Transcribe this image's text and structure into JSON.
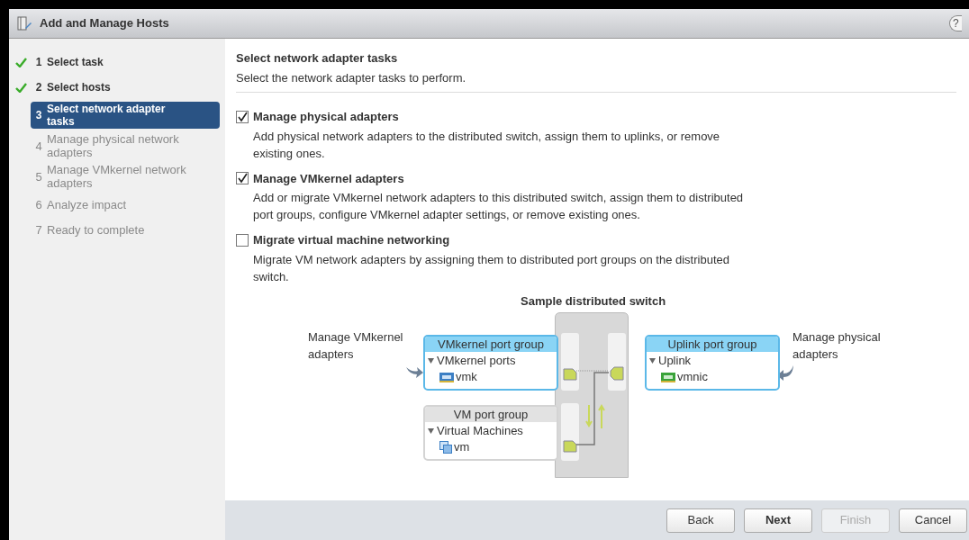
{
  "window": {
    "title": "Add and Manage Hosts",
    "help": "?"
  },
  "steps": [
    {
      "number": "1",
      "label": "Select task",
      "done": true,
      "selected": false,
      "disabled": false
    },
    {
      "number": "2",
      "label": "Select hosts",
      "done": true,
      "selected": false,
      "disabled": false
    },
    {
      "number": "3",
      "label": "Select network adapter tasks",
      "done": false,
      "selected": true,
      "disabled": false
    },
    {
      "number": "4",
      "label": "Manage physical network adapters",
      "done": false,
      "selected": false,
      "disabled": true
    },
    {
      "number": "5",
      "label": "Manage VMkernel network adapters",
      "done": false,
      "selected": false,
      "disabled": true
    },
    {
      "number": "6",
      "label": "Analyze impact",
      "done": false,
      "selected": false,
      "disabled": true
    },
    {
      "number": "7",
      "label": "Ready to complete",
      "done": false,
      "selected": false,
      "disabled": true
    }
  ],
  "page": {
    "title": "Select network adapter tasks",
    "subtitle": "Select the network adapter tasks to perform."
  },
  "tasks": [
    {
      "label": "Manage physical adapters",
      "checked": true,
      "description": "Add physical network adapters to the distributed switch, assign them to uplinks, or remove existing ones."
    },
    {
      "label": "Manage VMkernel adapters",
      "checked": true,
      "description": "Add or migrate VMkernel network adapters to this distributed switch, assign them to distributed port groups, configure VMkernel adapter settings, or remove existing ones."
    },
    {
      "label": "Migrate virtual machine networking",
      "checked": false,
      "description": "Migrate VM network adapters by assigning them to distributed port groups on the distributed switch."
    }
  ],
  "diagram": {
    "title": "Sample distributed switch",
    "left_note": "Manage VMkernel adapters",
    "right_note": "Manage physical adapters",
    "groups": [
      {
        "kind": "vmkernel",
        "title": "VMkernel port group",
        "highlighted": true,
        "node": "VMkernel ports",
        "item": "vmk"
      },
      {
        "kind": "vm",
        "title": "VM port group",
        "highlighted": false,
        "node": "Virtual Machines",
        "item": "vm"
      },
      {
        "kind": "uplink",
        "title": "Uplink port group",
        "highlighted": true,
        "node": "Uplink",
        "item": "vmnic"
      }
    ]
  },
  "buttons": [
    {
      "label": "Back",
      "disabled": false,
      "primary": false
    },
    {
      "label": "Next",
      "disabled": false,
      "primary": true
    },
    {
      "label": "Finish",
      "disabled": true,
      "primary": false
    },
    {
      "label": "Cancel",
      "disabled": false,
      "primary": false
    }
  ]
}
